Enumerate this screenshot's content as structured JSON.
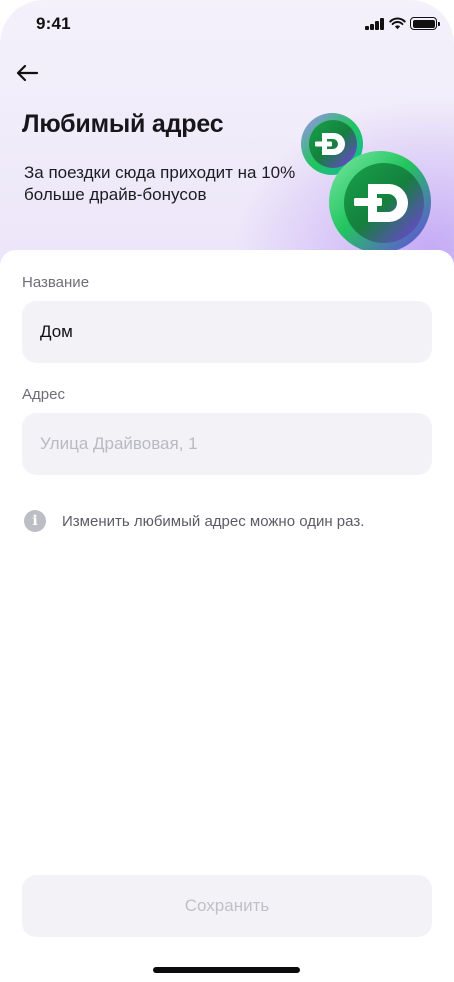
{
  "status_bar": {
    "time": "9:41"
  },
  "header": {
    "title": "Любимый адрес",
    "subtitle": "За поездки сюда приходит на 10% больше драйв-бонусов",
    "back_icon": "arrow-left-icon",
    "coin_icon": "drive-bonus-coin-icon"
  },
  "form": {
    "name_field": {
      "label": "Название",
      "value": "Дом",
      "placeholder": ""
    },
    "address_field": {
      "label": "Адрес",
      "value": "",
      "placeholder": "Улица Драйвовая, 1"
    }
  },
  "info": {
    "icon": "info-icon",
    "text": "Изменить любимый адрес можно один раз."
  },
  "footer": {
    "save_label": "Сохранить"
  },
  "colors": {
    "field_bg": "#f3f3f7",
    "hero_bg": "#efeaf9",
    "coin_green": "#22c55e",
    "coin_purple": "#8b5cf6",
    "disabled_text": "#bfbfc8"
  }
}
